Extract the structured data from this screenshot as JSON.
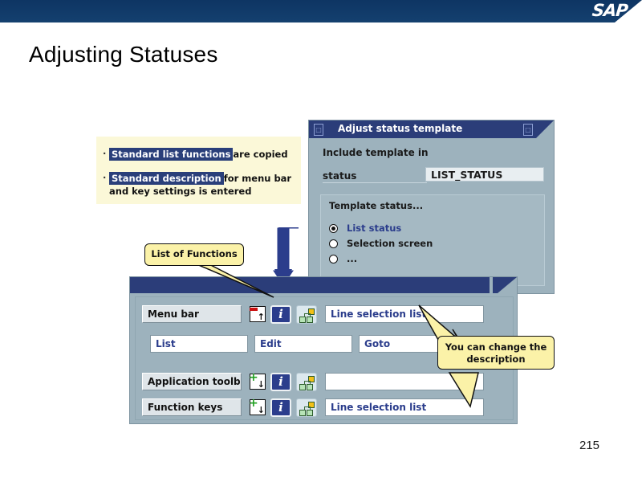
{
  "header": {
    "logo": "SAP",
    "logo_icon": "sap-logo"
  },
  "slide": {
    "title": "Adjusting Statuses",
    "page_number": "215"
  },
  "note_box": {
    "lines": [
      {
        "bullet": "·",
        "highlight": "Standard list functions",
        "rest": "are copied"
      },
      {
        "bullet": "·",
        "highlight": "Standard description",
        "rest": "for menu bar"
      },
      {
        "bullet": "",
        "highlight": "",
        "rest": "and key settings is entered"
      }
    ]
  },
  "dialog": {
    "title": "Adjust status template",
    "title_left_glyph": "□",
    "title_right_glyph": "□",
    "subtitle": "Include template in",
    "status_label": "status",
    "status_value": "LIST_STATUS",
    "group_title": "Template status...",
    "radios": [
      {
        "label": "List status",
        "selected": true
      },
      {
        "label": "Selection screen",
        "selected": false
      },
      {
        "label": "...",
        "selected": false
      }
    ]
  },
  "editor": {
    "rows": [
      {
        "label": "Menu bar",
        "value": "Line selection list",
        "icon1": "collapse-red-up-icon",
        "icon2": "info-icon",
        "icon3": "hierarchy-tree-icon"
      },
      {
        "label": "Application toolbar",
        "value": "",
        "icon1": "expand-green-down-icon",
        "icon2": "info-icon",
        "icon3": "hierarchy-tree-icon"
      },
      {
        "label": "Function keys",
        "value": "Line selection list",
        "icon1": "expand-green-down-icon",
        "icon2": "info-icon",
        "icon3": "hierarchy-tree-icon"
      }
    ],
    "menu_items": [
      "List",
      "Edit",
      "Goto"
    ],
    "info_glyph": "i"
  },
  "callouts": {
    "functions": "List of Functions",
    "description_line1": "You can change the",
    "description_line2": "description"
  },
  "colors": {
    "sap_navy": "#123c6b",
    "title_navy": "#2b3d79",
    "dialog_body": "#9db2bd",
    "note_yellow": "#fbf8d8",
    "callout_yellow": "#fbf2a8",
    "highlight_navy": "#2a3f7a",
    "link_blue": "#2b3d8c",
    "green": "#21a021",
    "red": "#cc1111",
    "amber": "#f2c017"
  }
}
